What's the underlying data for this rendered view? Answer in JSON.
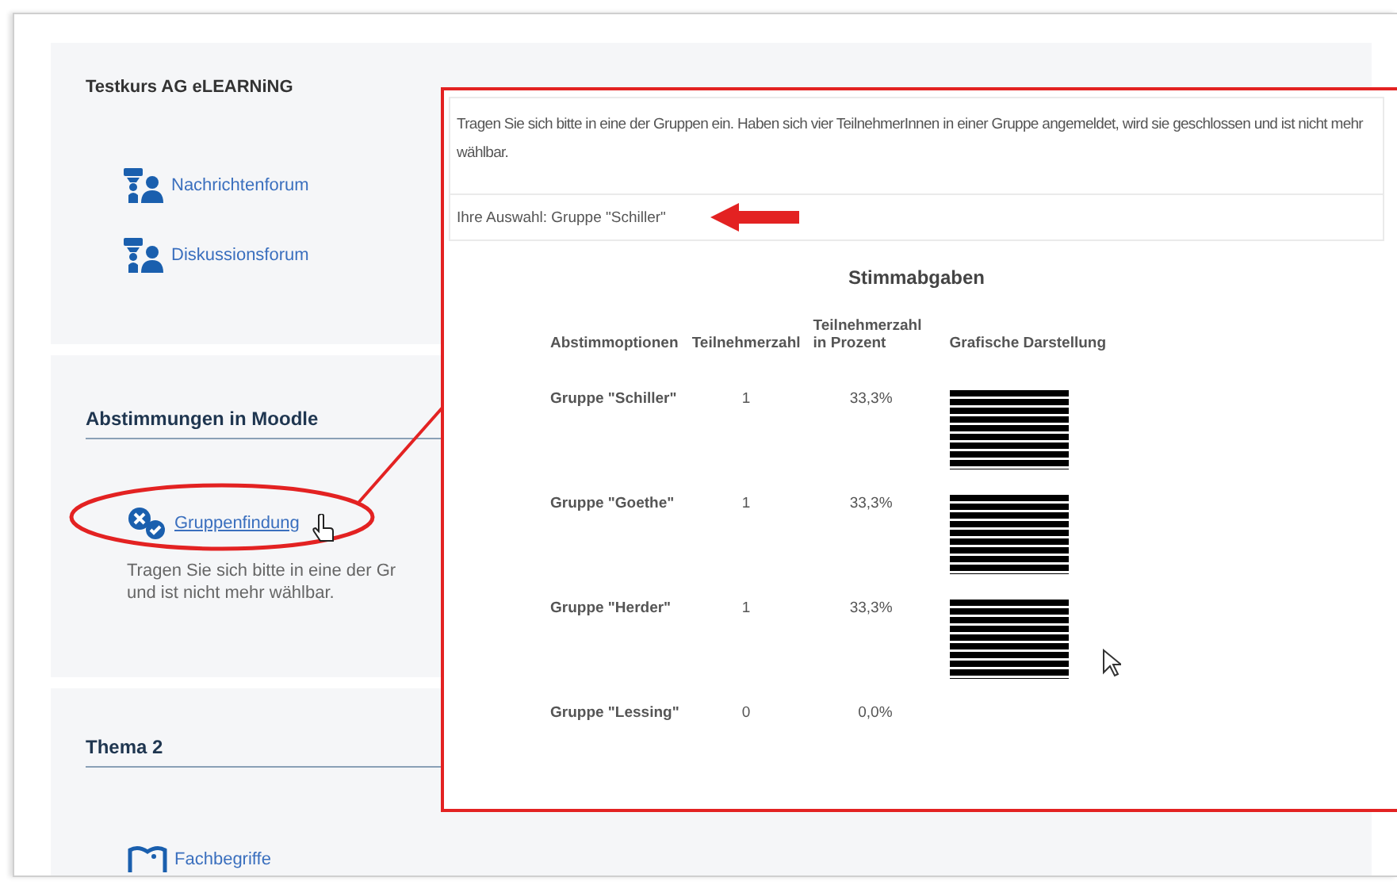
{
  "course": {
    "title": "Testkurs AG eLEARNiNG",
    "links": [
      {
        "label": "Nachrichtenforum",
        "kind": "forum"
      },
      {
        "label": "Diskussionsforum",
        "kind": "forum"
      }
    ]
  },
  "sections": [
    {
      "heading": "Abstimmungen in Moodle",
      "activity": {
        "label": "Gruppenfindung",
        "kind": "choice",
        "description_lines": [
          "Tragen Sie sich bitte in eine der Gr",
          "und ist nicht mehr wählbar."
        ]
      }
    },
    {
      "heading": "Thema 2",
      "activity": {
        "label": "Fachbegriffe",
        "kind": "glossary"
      }
    }
  ],
  "popup": {
    "intro": "Tragen Sie sich bitte in eine der Gruppen ein. Haben sich vier TeilnehmerInnen in einer Gruppe angemeldet, wird sie geschlossen und ist nicht mehr wählbar.",
    "selection": "Ihre Auswahl: Gruppe \"Schiller\"",
    "results_title": "Stimmabgaben",
    "columns": [
      "Abstimmoptionen",
      "Teilnehmerzahl",
      "Teilnehmerzahl in Prozent",
      "Grafische Darstellung"
    ],
    "rows": [
      {
        "option": "Gruppe \"Schiller\"",
        "count": "1",
        "percent": "33,3%",
        "level": 0.333
      },
      {
        "option": "Gruppe \"Goethe\"",
        "count": "1",
        "percent": "33,3%",
        "level": 0.333
      },
      {
        "option": "Gruppe \"Herder\"",
        "count": "1",
        "percent": "33,3%",
        "level": 0.333
      },
      {
        "option": "Gruppe \"Lessing\"",
        "count": "0",
        "percent": "0,0%"
      }
    ]
  }
}
